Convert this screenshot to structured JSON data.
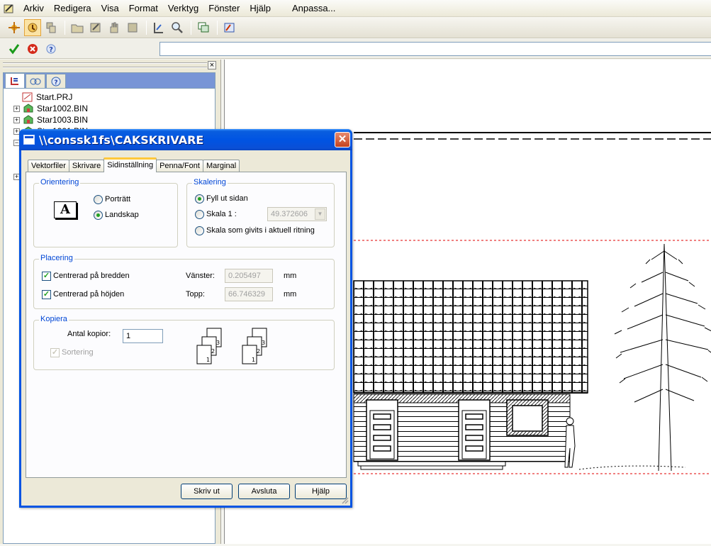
{
  "menu": {
    "items": [
      "Arkiv",
      "Redigera",
      "Visa",
      "Format",
      "Verktyg",
      "Fönster",
      "Hjälp"
    ],
    "extra": "Anpassa..."
  },
  "tree": {
    "items": [
      "Start.PRJ",
      "Star1002.BIN",
      "Star1003.BIN",
      "Star1001.BIN"
    ]
  },
  "dialog": {
    "title": "\\\\conssk1fs\\CAKSKRIVARE",
    "close": "✕",
    "tabs": [
      "Vektorfiler",
      "Skrivare",
      "Sidinställning",
      "Penna/Font",
      "Marginal"
    ],
    "orientation": {
      "title": "Orientering",
      "portrait": "Porträtt",
      "landscape": "Landskap",
      "preview_letter": "A"
    },
    "scaling": {
      "title": "Skalering",
      "fill": "Fyll ut sidan",
      "scale": "Skala 1 :",
      "scale_value": "49.372606",
      "actual": "Skala som givits i aktuell ritning"
    },
    "placement": {
      "title": "Placering",
      "center_width": "Centrerad på bredden",
      "center_height": "Centrerad på höjden",
      "left_label": "Vänster:",
      "left_value": "0.205497",
      "top_label": "Topp:",
      "top_value": "66.746329",
      "unit": "mm"
    },
    "copies": {
      "title": "Kopiera",
      "count_label": "Antal kopior:",
      "count_value": "1",
      "collate": "Sortering"
    },
    "buttons": {
      "print": "Skriv ut",
      "close": "Avsluta",
      "help": "Hjälp"
    }
  },
  "colors": {
    "title_bar": "#0054e3",
    "group_title": "#0046d5",
    "tab_highlight": "#ffc83c",
    "drawing_red_dashed": "#e00000"
  }
}
